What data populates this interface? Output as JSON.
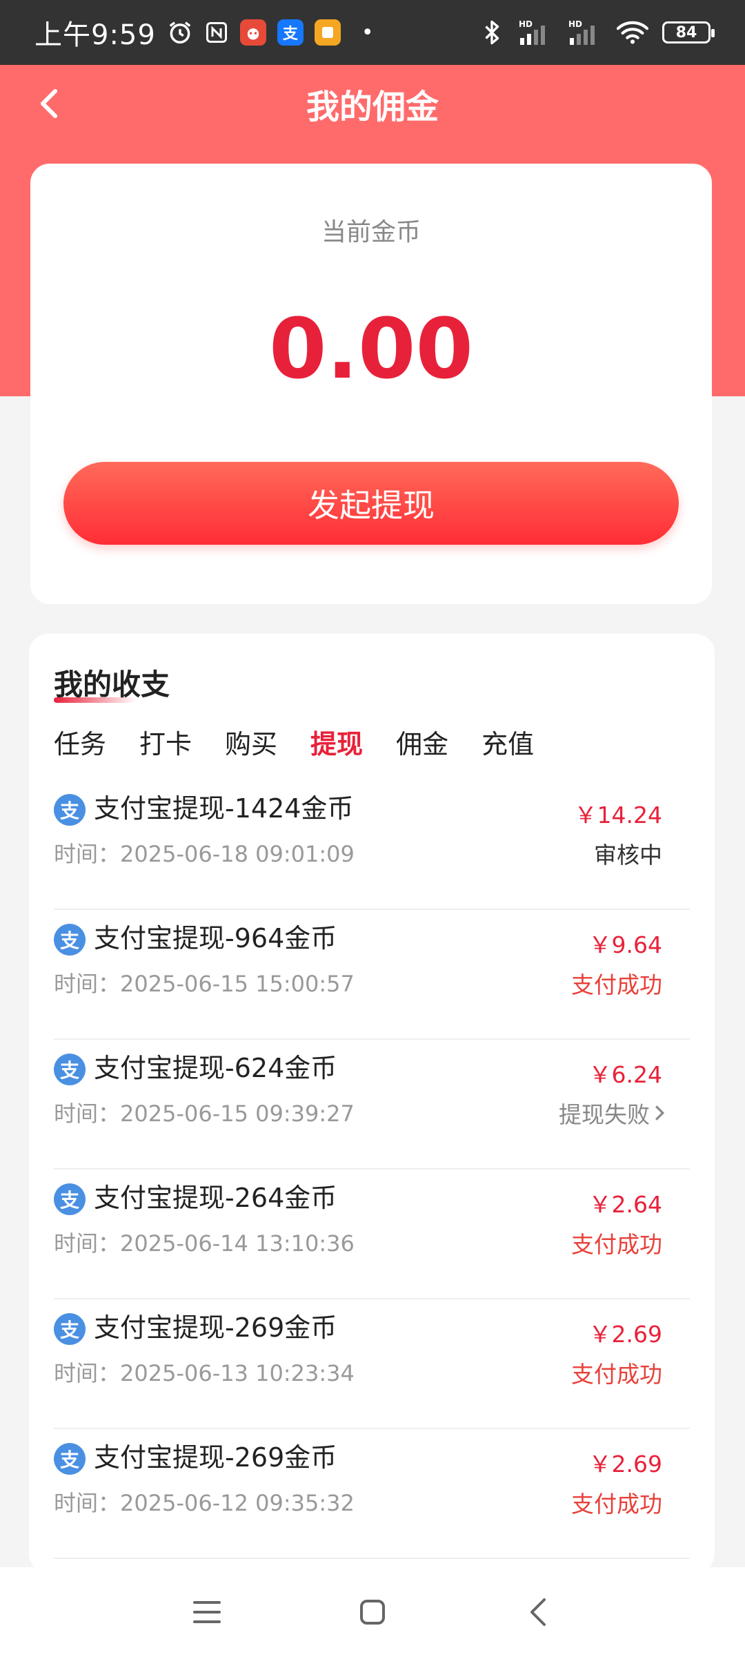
{
  "status_bar": {
    "time": "上午9:59",
    "dot": "•",
    "battery": "84",
    "signal_label_1": "HD",
    "signal_label_2": "HD",
    "app_icon_label": "支"
  },
  "header": {
    "title": "我的佣金"
  },
  "coin_card": {
    "label": "当前金币",
    "value": "0.00",
    "withdraw_label": "发起提现"
  },
  "records": {
    "section_title": "我的收支",
    "tabs": [
      {
        "label": "任务",
        "active": false
      },
      {
        "label": "打卡",
        "active": false
      },
      {
        "label": "购买",
        "active": false
      },
      {
        "label": "提现",
        "active": true
      },
      {
        "label": "佣金",
        "active": false
      },
      {
        "label": "充值",
        "active": false
      }
    ],
    "items": [
      {
        "title": "支付宝提现-1424金币",
        "time": "时间：2025-06-18 09:01:09",
        "amount": "￥14.24",
        "status": "审核中"
      },
      {
        "title": "支付宝提现-964金币",
        "time": "时间：2025-06-15 15:00:57",
        "amount": "￥9.64",
        "status": "支付成功"
      },
      {
        "title": "支付宝提现-624金币",
        "time": "时间：2025-06-15 09:39:27",
        "amount": "￥6.24",
        "status": "提现失败"
      },
      {
        "title": "支付宝提现-264金币",
        "time": "时间：2025-06-14 13:10:36",
        "amount": "￥2.64",
        "status": "支付成功"
      },
      {
        "title": "支付宝提现-269金币",
        "time": "时间：2025-06-13 10:23:34",
        "amount": "￥2.69",
        "status": "支付成功"
      },
      {
        "title": "支付宝提现-269金币",
        "time": "时间：2025-06-12 09:35:32",
        "amount": "￥2.69",
        "status": "支付成功"
      }
    ],
    "alipay_icon_label": "支"
  },
  "colors": {
    "header_bg": "#ff6b6b",
    "accent_red": "#e8213a",
    "status_bar_bg": "#333333",
    "alipay_blue": "#4a90e2"
  },
  "icons": {
    "back": "chevron-left-icon",
    "record": "alipay-icon",
    "failed_arrow": "chevron-right-icon",
    "nav": [
      "menu-icon",
      "home-icon",
      "back-icon"
    ]
  }
}
